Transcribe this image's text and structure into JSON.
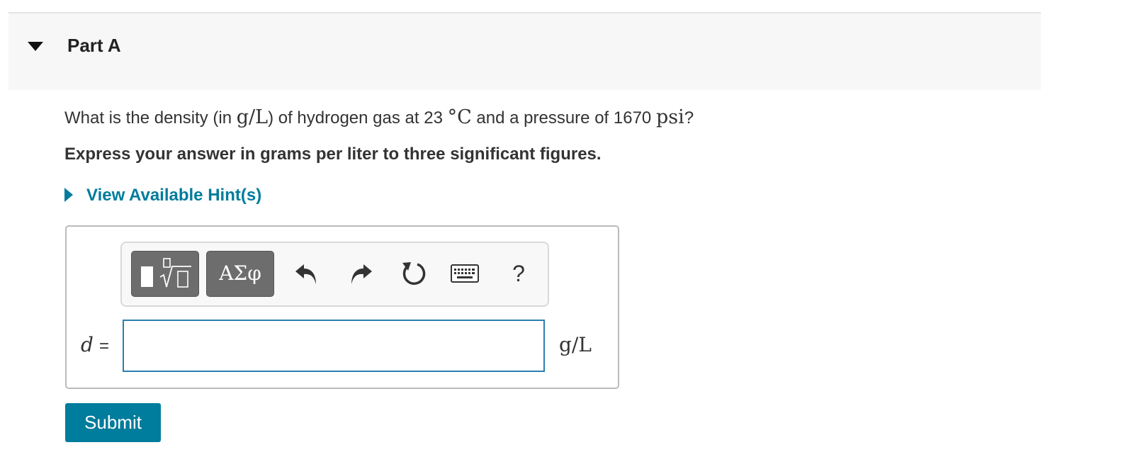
{
  "part": {
    "title": "Part A"
  },
  "question": {
    "text_1": "What is the density (in ",
    "unit_1": "g/L",
    "text_2": ") of hydrogen gas at 23 ",
    "temp_unit": "°C",
    "text_3": " and a pressure of 1670 ",
    "pressure_unit": "psi",
    "text_4": "?"
  },
  "instructions": "Express your answer in grams per liter to three significant figures.",
  "hint": {
    "label": "View Available Hint(s)"
  },
  "toolbar": {
    "symbols_label": "ΑΣφ",
    "help_label": "?",
    "icons": [
      "templates-icon",
      "undo-icon",
      "redo-icon",
      "reset-icon",
      "keyboard-icon",
      "help-icon"
    ]
  },
  "answer": {
    "variable": "d",
    "equals": "=",
    "value": "",
    "unit": "g/L"
  },
  "submit": {
    "label": "Submit"
  },
  "colors": {
    "accent": "#007c9c",
    "input_border": "#2a7fb0",
    "toolbar_button": "#6d6d6d"
  }
}
